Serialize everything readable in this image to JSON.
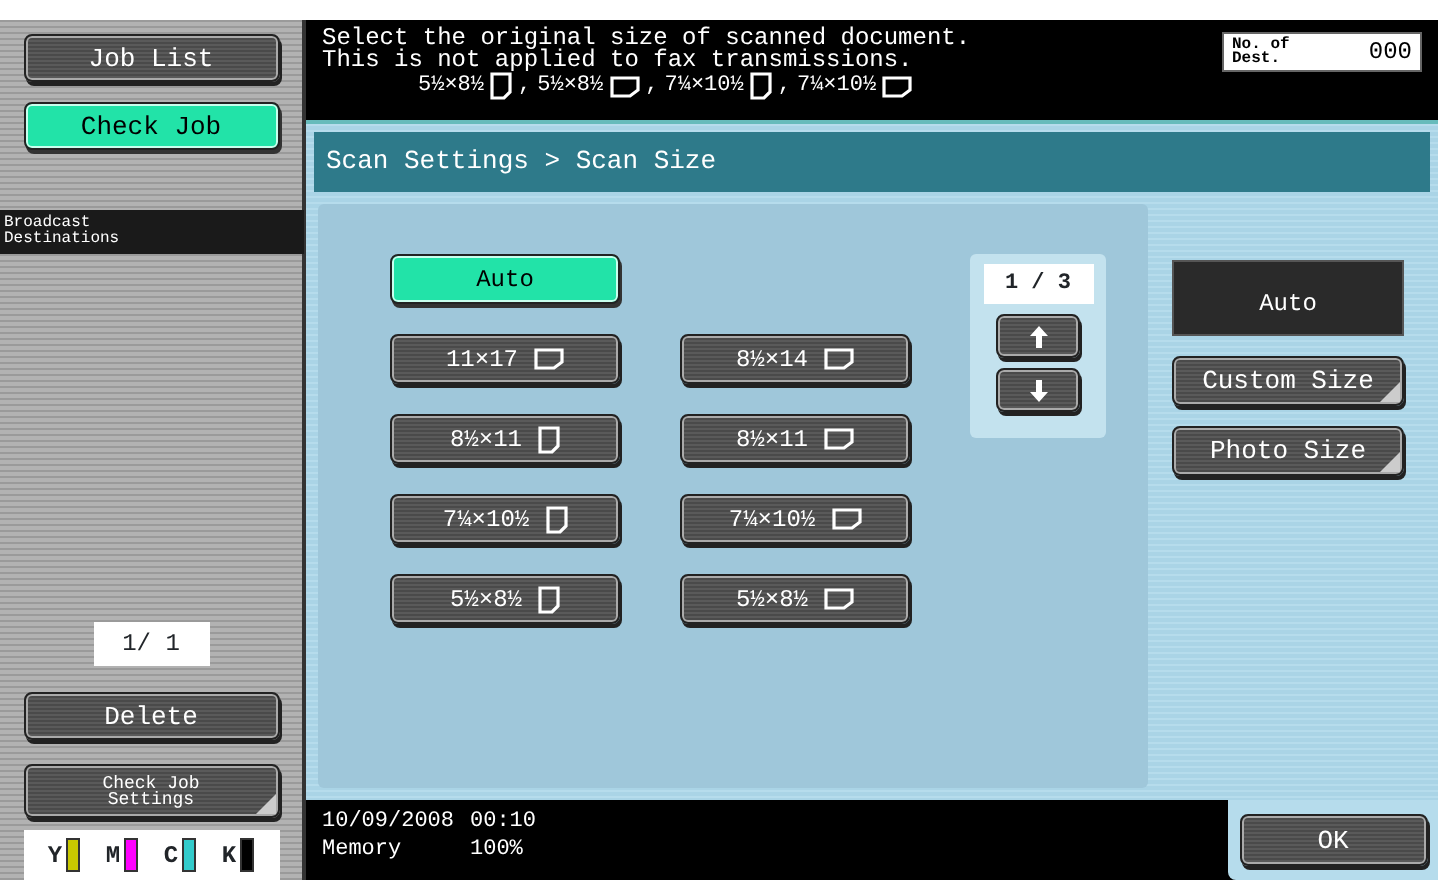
{
  "left_panel": {
    "buttons": [
      {
        "label": "Job List",
        "selected": false
      },
      {
        "label": "Check Job",
        "selected": true
      }
    ],
    "section_title": "Broadcast Destinations",
    "counter": "1/ 1",
    "delete_button": "Delete",
    "settings_button": "Check Job Settings",
    "toners": [
      {
        "label": "Y",
        "color": "#c8c800"
      },
      {
        "label": "M",
        "color": "#ff00ff"
      },
      {
        "label": "C",
        "color": "#33cccc"
      },
      {
        "label": "K",
        "color": "#000000"
      }
    ]
  },
  "header": {
    "lines": [
      "Select the original size of scanned document.",
      "This is not applied to fax transmissions."
    ],
    "sizes": [
      {
        "text": "5½×8½",
        "kind": "portrait",
        "suffix": ","
      },
      {
        "text": "5½×8½",
        "kind": "landscape",
        "suffix": ","
      },
      {
        "text": "7¼×10½",
        "kind": "portrait",
        "suffix": ","
      },
      {
        "text": "7¼×10½",
        "kind": "landscape"
      }
    ],
    "dest_label": "No. of Dest.",
    "dest_count": "000"
  },
  "panel": {
    "breadcrumb": "Scan Settings > Scan Size",
    "auto_button": {
      "label": "Auto",
      "selected": true
    },
    "sizes": [
      {
        "label": "11×17",
        "kind": "landscape",
        "selected": false
      },
      {
        "label": "8½×14",
        "kind": "landscape",
        "selected": false
      },
      {
        "label": "8½×11",
        "kind": "portrait",
        "selected": false
      },
      {
        "label": "8½×11",
        "kind": "landscape",
        "selected": false
      },
      {
        "label": "7¼×10½",
        "kind": "portrait",
        "selected": false
      },
      {
        "label": "7¼×10½",
        "kind": "landscape",
        "selected": false
      },
      {
        "label": "5½×8½",
        "kind": "portrait",
        "selected": false
      },
      {
        "label": "5½×8½",
        "kind": "landscape",
        "selected": false
      }
    ],
    "page": "1 / 3",
    "current_size": "Auto",
    "side_buttons": [
      "Custom Size",
      "Photo Size"
    ]
  },
  "status_bar": {
    "date": "10/09/2008",
    "time": "00:10",
    "memory_label": "Memory",
    "memory_value": "100%"
  },
  "ok_button": "OK"
}
